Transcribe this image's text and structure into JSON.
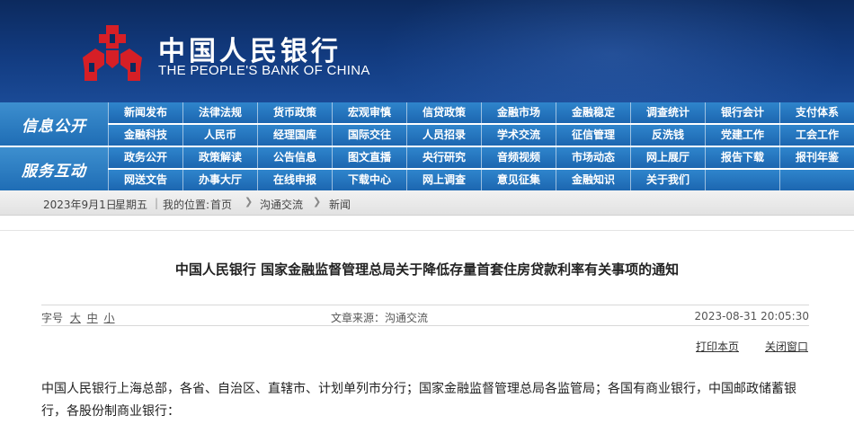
{
  "header": {
    "logo_cn": "中国人民银行",
    "logo_en": "THE PEOPLE'S BANK OF CHINA",
    "logo_color": "#d61f26",
    "bg_color": "#123b80"
  },
  "nav": {
    "info_label": "信息公开",
    "service_label": "服务互动",
    "rows": [
      [
        "新闻发布",
        "法律法规",
        "货币政策",
        "宏观审慎",
        "信贷政策",
        "金融市场",
        "金融稳定",
        "调查统计",
        "银行会计",
        "支付体系"
      ],
      [
        "金融科技",
        "人民币",
        "经理国库",
        "国际交往",
        "人员招录",
        "学术交流",
        "征信管理",
        "反洗钱",
        "党建工作",
        "工会工作"
      ],
      [
        "政务公开",
        "政策解读",
        "公告信息",
        "图文直播",
        "央行研究",
        "音频视频",
        "市场动态",
        "网上展厅",
        "报告下载",
        "报刊年鉴"
      ],
      [
        "网送文告",
        "办事大厅",
        "在线申报",
        "下载中心",
        "网上调查",
        "意见征集",
        "金融知识",
        "关于我们",
        "",
        ""
      ]
    ]
  },
  "breadcrumb": {
    "date": "2023年9月1日",
    "weekday": "星期五",
    "location_label": "我的位置:",
    "home": "首页",
    "level1": "沟通交流",
    "level2": "新闻"
  },
  "article": {
    "title": "中国人民银行 国家金融监督管理总局关于降低存量首套住房贷款利率有关事项的通知",
    "font_size_label": "字号",
    "font_sizes": [
      "大",
      "中",
      "小"
    ],
    "source": "文章来源：沟通交流",
    "datetime": "2023-08-31  20:05:30",
    "print_label": "打印本页",
    "close_label": "关闭窗口",
    "body": "中国人民银行上海总部，各省、自治区、直辖市、计划单列市分行；国家金融监督管理总局各监管局；各国有商业银行，中国邮政储蓄银行，各股份制商业银行："
  }
}
